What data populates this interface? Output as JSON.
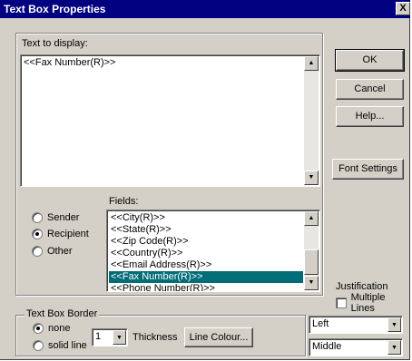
{
  "window": {
    "title": "Text Box Properties",
    "close_glyph": "X"
  },
  "text_group": {
    "label": "Text to display:",
    "value": "<<Fax Number(R)>>"
  },
  "buttons": {
    "ok": "OK",
    "cancel": "Cancel",
    "help": "Help...",
    "font_settings": "Font Settings"
  },
  "fields": {
    "label": "Fields:",
    "items": [
      "<<City(R)>>",
      "<<State(R)>>",
      "<<Zip Code(R)>>",
      "<<Country(R)>>",
      "<<Email Address(R)>>",
      "<<Fax Number(R)>>",
      "<<Phone Number(R)>>"
    ],
    "selected": "<<Fax Number(R)>>"
  },
  "recipient_type": {
    "options": [
      "Sender",
      "Recipient",
      "Other"
    ],
    "selected": "Recipient"
  },
  "justification": {
    "label": "Justification",
    "multiple_lines_label": "Multiple Lines",
    "multiple_lines_checked": false,
    "horizontal": "Left",
    "vertical": "Middle"
  },
  "border": {
    "group_label": "Text Box Border",
    "options": [
      "none",
      "solid line"
    ],
    "selected": "none",
    "thickness_value": "1",
    "thickness_label": "Thickness",
    "line_colour_button": "Line Colour..."
  },
  "colors": {
    "title_bar": "#000080",
    "selection": "#006d77",
    "face": "#d4d0c8"
  }
}
